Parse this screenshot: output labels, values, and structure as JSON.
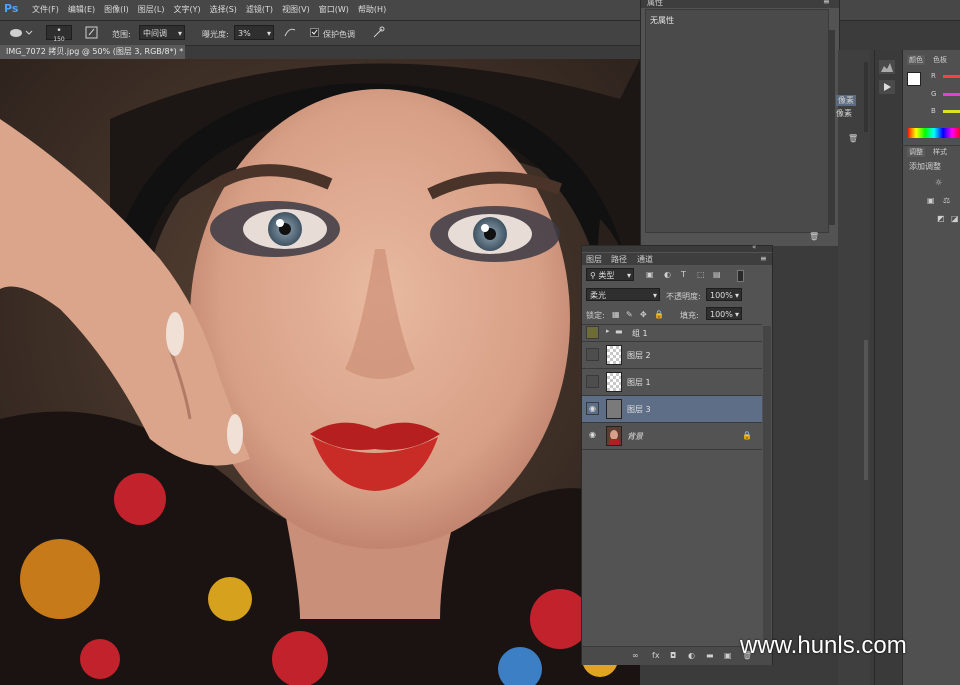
{
  "app": {
    "logo": "Ps"
  },
  "menu": [
    "文件(F)",
    "编辑(E)",
    "图像(I)",
    "图层(L)",
    "文字(Y)",
    "选择(S)",
    "滤镜(T)",
    "视图(V)",
    "窗口(W)",
    "帮助(H)"
  ],
  "options": {
    "brush_size": "150",
    "range_label": "范围:",
    "range_value": "中间调",
    "exposure_label": "曝光度:",
    "exposure_value": "3%",
    "protect_tones_label": "保护色调"
  },
  "document": {
    "tab_title": "IMG_7072 拷贝.jpg @ 50% (图层 3, RGB/8*) *"
  },
  "properties": {
    "title": "属性",
    "message": "无属性"
  },
  "mid_panel": {
    "items": [
      "像素",
      "像素"
    ]
  },
  "color_panel": {
    "tabs": [
      "颜色",
      "色板"
    ],
    "channels": [
      "R",
      "G",
      "B"
    ]
  },
  "adjust_panel": {
    "tabs": [
      "调整",
      "样式"
    ],
    "title": "添加调整"
  },
  "layers": {
    "tabs": [
      "图层",
      "路径",
      "通道"
    ],
    "filter_kind": "类型",
    "blend_mode": "柔光",
    "opacity_label": "不透明度:",
    "opacity_value": "100%",
    "lock_label": "锁定:",
    "fill_label": "填充:",
    "fill_value": "100%",
    "items": [
      {
        "name": "组 1",
        "type": "group"
      },
      {
        "name": "图层 2",
        "type": "layer"
      },
      {
        "name": "图层 1",
        "type": "layer"
      },
      {
        "name": "图层 3",
        "type": "layer"
      },
      {
        "name": "背景",
        "type": "background"
      }
    ],
    "bottom_icons": [
      "link-icon",
      "fx-icon",
      "mask-icon",
      "adjustment-icon",
      "folder-icon",
      "new-layer-icon",
      "trash-icon"
    ]
  },
  "watermark": "www.hunls.com"
}
